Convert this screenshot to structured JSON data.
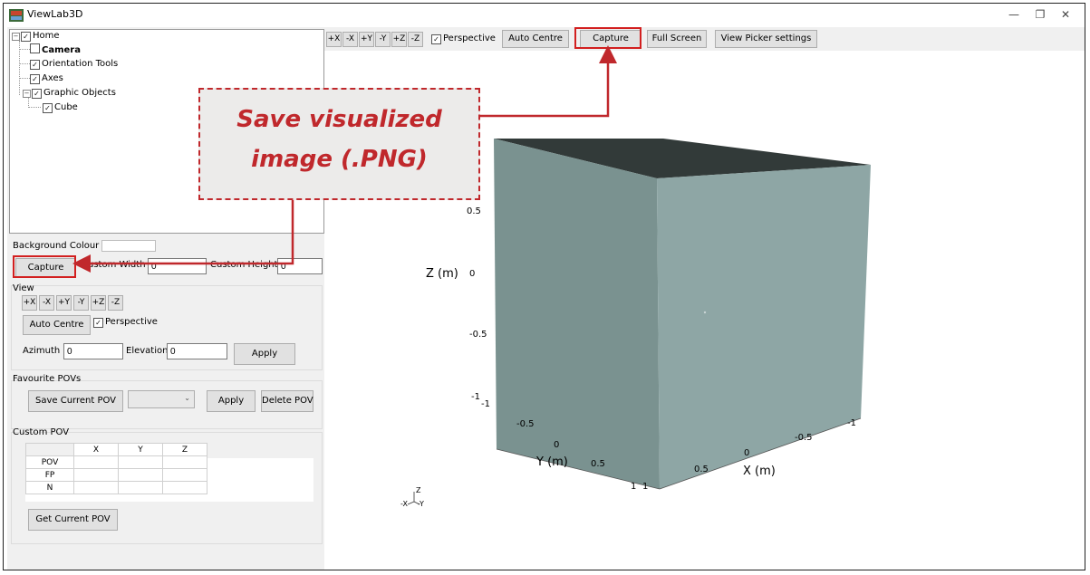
{
  "window": {
    "title": "ViewLab3D",
    "minimize": "—",
    "maximize": "❐",
    "close": "✕"
  },
  "tree": {
    "home": "Home",
    "camera": "Camera",
    "orientation": "Orientation Tools",
    "axes": "Axes",
    "graphics": "Graphic Objects",
    "cube": "Cube"
  },
  "left": {
    "bg_label": "Background Colour",
    "capture": "Capture",
    "custom_width_label": "Custom Width",
    "custom_width_value": "0",
    "custom_height_label": "Custom Height",
    "custom_height_value": "0",
    "view_label": "View",
    "view_buttons": [
      "+X",
      "-X",
      "+Y",
      "-Y",
      "+Z",
      "-Z"
    ],
    "auto_centre": "Auto Centre",
    "perspective": "Perspective",
    "azimuth_label": "Azimuth",
    "azimuth_value": "0",
    "elevation_label": "Elevation",
    "elevation_value": "0",
    "apply": "Apply",
    "fav_label": "Favourite POVs",
    "save_pov": "Save Current POV",
    "fav_apply": "Apply",
    "delete_pov": "Delete POV",
    "custom_pov_label": "Custom POV",
    "col_x": "X",
    "col_y": "Y",
    "col_z": "Z",
    "row_pov": "POV",
    "row_fp": "FP",
    "row_n": "N",
    "get_pov": "Get Current POV"
  },
  "toolbar": {
    "view_buttons": [
      "+X",
      "-X",
      "+Y",
      "-Y",
      "+Z",
      "-Z"
    ],
    "perspective": "Perspective",
    "auto_centre": "Auto Centre",
    "capture": "Capture",
    "full_screen": "Full Screen",
    "picker": "View Picker settings"
  },
  "callout": {
    "line1": "Save visualized",
    "line2": "image (.PNG)"
  },
  "axes3d": {
    "z_label": "Z (m)",
    "y_label": "Y (m)",
    "x_label": "X (m)",
    "z_ticks": [
      "0.5",
      "0",
      "-0.5",
      "-1"
    ],
    "y_ticks": [
      "-1",
      "-0.5",
      "0",
      "0.5",
      "1"
    ],
    "x_ticks": [
      "-1",
      "-0.5",
      "0",
      "0.5",
      "1"
    ],
    "triad": {
      "z": "Z",
      "x": "-X",
      "y": "-Y"
    }
  },
  "colors": {
    "accent": "#d21f1f",
    "cube_front": "#7a9290",
    "cube_side": "#8ea6a5",
    "cube_top": "#323a39"
  }
}
